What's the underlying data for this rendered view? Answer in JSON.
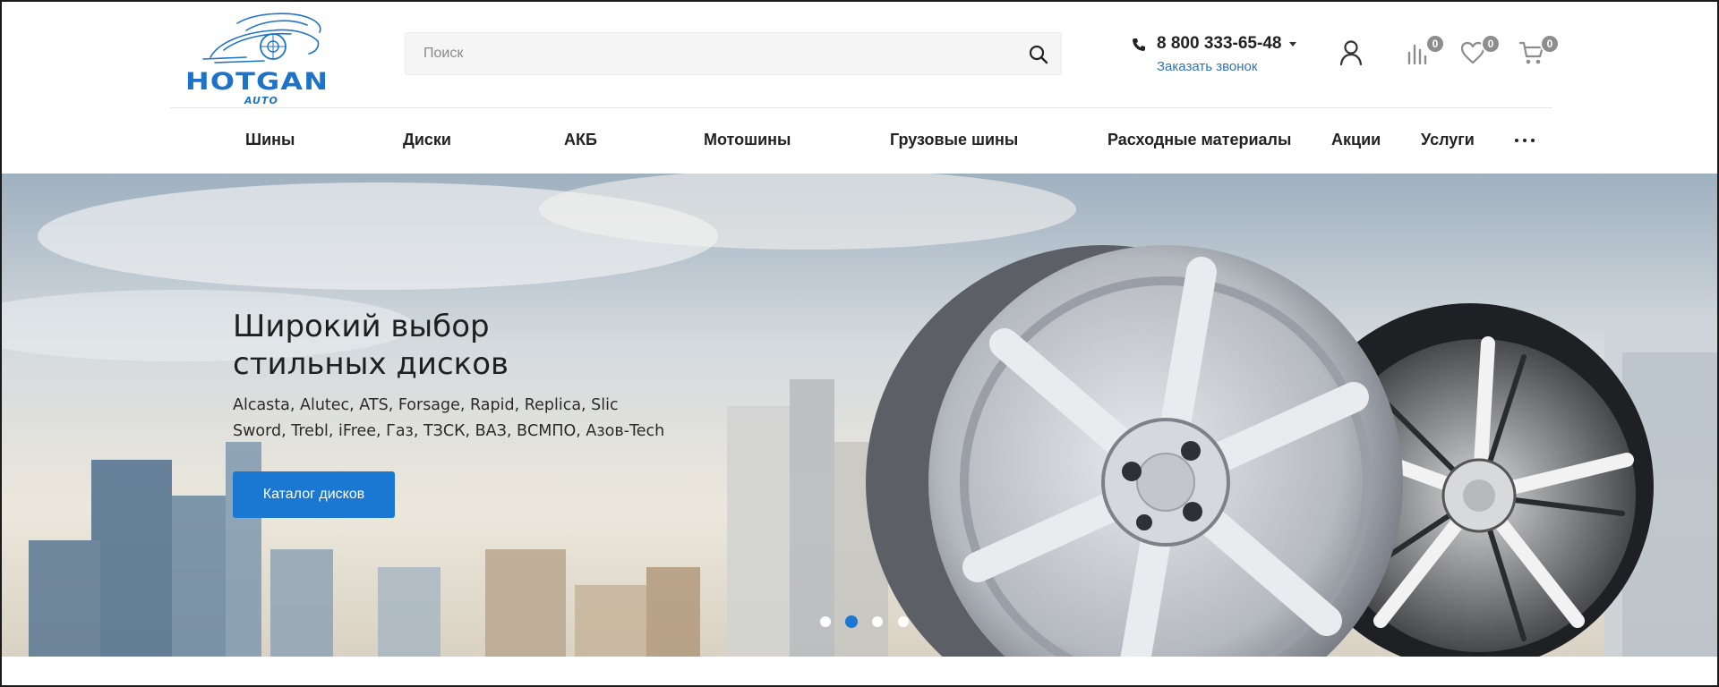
{
  "header": {
    "logo": {
      "name": "HOTGAN",
      "sub": "AUTO"
    },
    "search": {
      "placeholder": "Поиск"
    },
    "phone": {
      "number": "8 800 333-65-48",
      "callback": "Заказать звонок"
    },
    "icons": {
      "account": "user-icon",
      "compare": {
        "icon": "compare-icon",
        "count": "0"
      },
      "favorites": {
        "icon": "heart-icon",
        "count": "0"
      },
      "cart": {
        "icon": "cart-icon",
        "count": "0"
      }
    }
  },
  "nav": {
    "items": [
      {
        "label": "Шины"
      },
      {
        "label": "Диски"
      },
      {
        "label": "АКБ"
      },
      {
        "label": "Мотошины"
      },
      {
        "label": "Грузовые шины"
      },
      {
        "label": "Расходные материалы"
      },
      {
        "label": "Акции"
      },
      {
        "label": "Услуги"
      }
    ],
    "more_icon": "more-dots-icon"
  },
  "hero": {
    "title_line1": "Широкий выбор",
    "title_line2": "стильных дисков",
    "brands_line1": "Alcasta, Alutec, ATS, Forsage, Rapid, Replica, Slic",
    "brands_line2": "Sword, Trebl, iFree, Газ, ТЗСК, ВАЗ, ВСМПО, Азов-Tech",
    "button_label": "Каталог дисков",
    "slides_total": 4,
    "active_slide": 2
  },
  "colors": {
    "accent": "#1a77d2",
    "logo": "#1d73c9",
    "link": "#2f73b6",
    "badge": "#8d8d8d"
  }
}
